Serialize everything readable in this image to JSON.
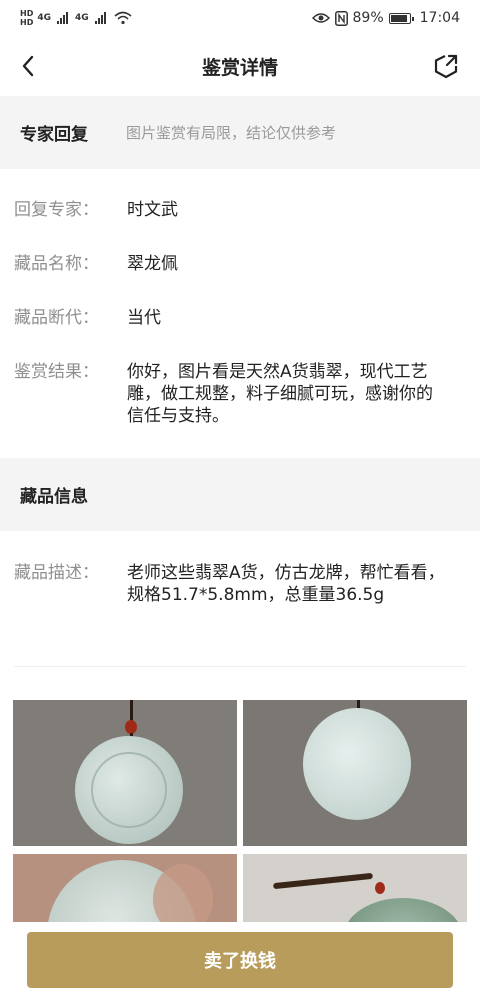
{
  "status_bar": {
    "hd_top": "HD",
    "hd_bottom": "HD",
    "net1": "4G",
    "net2": "4G",
    "battery_percent": "89%",
    "battery_level": 0.89,
    "time": "17:04"
  },
  "nav": {
    "title": "鉴赏详情",
    "back_icon": "chevron-left-icon",
    "share_icon": "share-icon"
  },
  "expert_section": {
    "label": "专家回复",
    "note": "图片鉴赏有局限，结论仅供参考"
  },
  "details": [
    {
      "key": "回复专家：",
      "value": "时文武"
    },
    {
      "key": "藏品名称：",
      "value": "翠龙佩"
    },
    {
      "key": "藏品断代：",
      "value": "当代"
    },
    {
      "key": "鉴赏结果：",
      "value": "你好，图片看是天然A货翡翠，现代工艺雕，做工规整，料子细腻可玩，感谢你的信任与支持。"
    }
  ],
  "collection_section": {
    "label": "藏品信息"
  },
  "description": {
    "key": "藏品描述：",
    "value": "老师这些翡翠A货，仿古龙牌，帮忙看看，规格51.7*5.8mm，总重量36.5g"
  },
  "photos": [
    "jade-front-photo",
    "jade-back-photo",
    "jade-closeup-photo",
    "jade-cord-photo"
  ],
  "action": {
    "sell_label": "卖了换钱"
  },
  "colors": {
    "accent": "#b79c5c",
    "section_bg": "#f4f4f4",
    "muted_text": "#8f8f8f"
  }
}
